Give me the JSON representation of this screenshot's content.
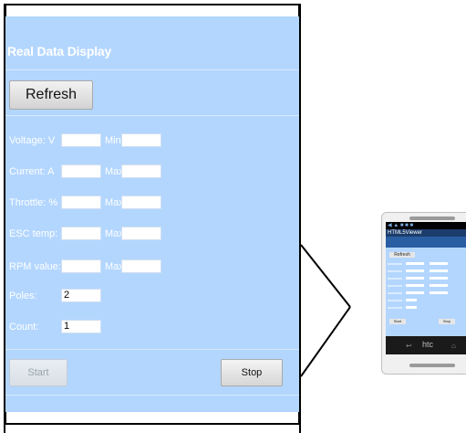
{
  "screen": {
    "title": "Real Data Display",
    "refresh_label": "Refresh",
    "rows": [
      {
        "label": "Voltage: V",
        "value": "",
        "side_label": "Min :",
        "side_value": ""
      },
      {
        "label": "Current: A",
        "value": "",
        "side_label": "Max:",
        "side_value": ""
      },
      {
        "label": "Throttle: %",
        "value": "",
        "side_label": "Max:",
        "side_value": ""
      },
      {
        "label": "ESC temp: C",
        "value": "",
        "side_label": "Max:",
        "side_value": ""
      },
      {
        "label": "RPM value:",
        "value": "",
        "side_label": "Max:",
        "side_value": ""
      },
      {
        "label": "Poles:",
        "value": "2"
      },
      {
        "label": "Count:",
        "value": "1"
      }
    ],
    "start_label": "Start",
    "stop_label": "Stop"
  },
  "phone": {
    "brand": "htc",
    "app_name": "HTML5Viewer",
    "mini_title": "Real Data Display",
    "mini_refresh": "Refresh",
    "mini_start": "Start",
    "mini_stop": "Stop"
  },
  "colors": {
    "screen_bg": "#b3d6ff",
    "label_text": "#ffffff",
    "phone_appbar": "#1c3d6b",
    "phone_tabs": "#2a5ea3"
  }
}
